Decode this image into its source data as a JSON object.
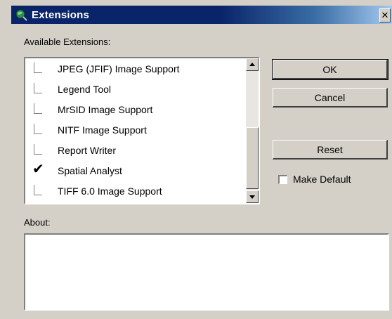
{
  "window": {
    "title": "Extensions",
    "close_glyph": "✕"
  },
  "available_label": "Available Extensions:",
  "extensions": [
    {
      "label": "JPEG (JFIF) Image Support",
      "checked": false
    },
    {
      "label": "Legend Tool",
      "checked": false
    },
    {
      "label": "MrSID Image Support",
      "checked": false
    },
    {
      "label": "NITF Image Support",
      "checked": false
    },
    {
      "label": "Report Writer",
      "checked": false
    },
    {
      "label": "Spatial Analyst",
      "checked": true
    },
    {
      "label": "TIFF 6.0 Image Support",
      "checked": false
    }
  ],
  "buttons": {
    "ok": "OK",
    "cancel": "Cancel",
    "reset": "Reset"
  },
  "make_default": {
    "label": "Make Default",
    "checked": false
  },
  "about_label": "About:",
  "about_text": "",
  "icons": {
    "title": "arcview-globe-icon",
    "check": "checkmark-icon"
  }
}
